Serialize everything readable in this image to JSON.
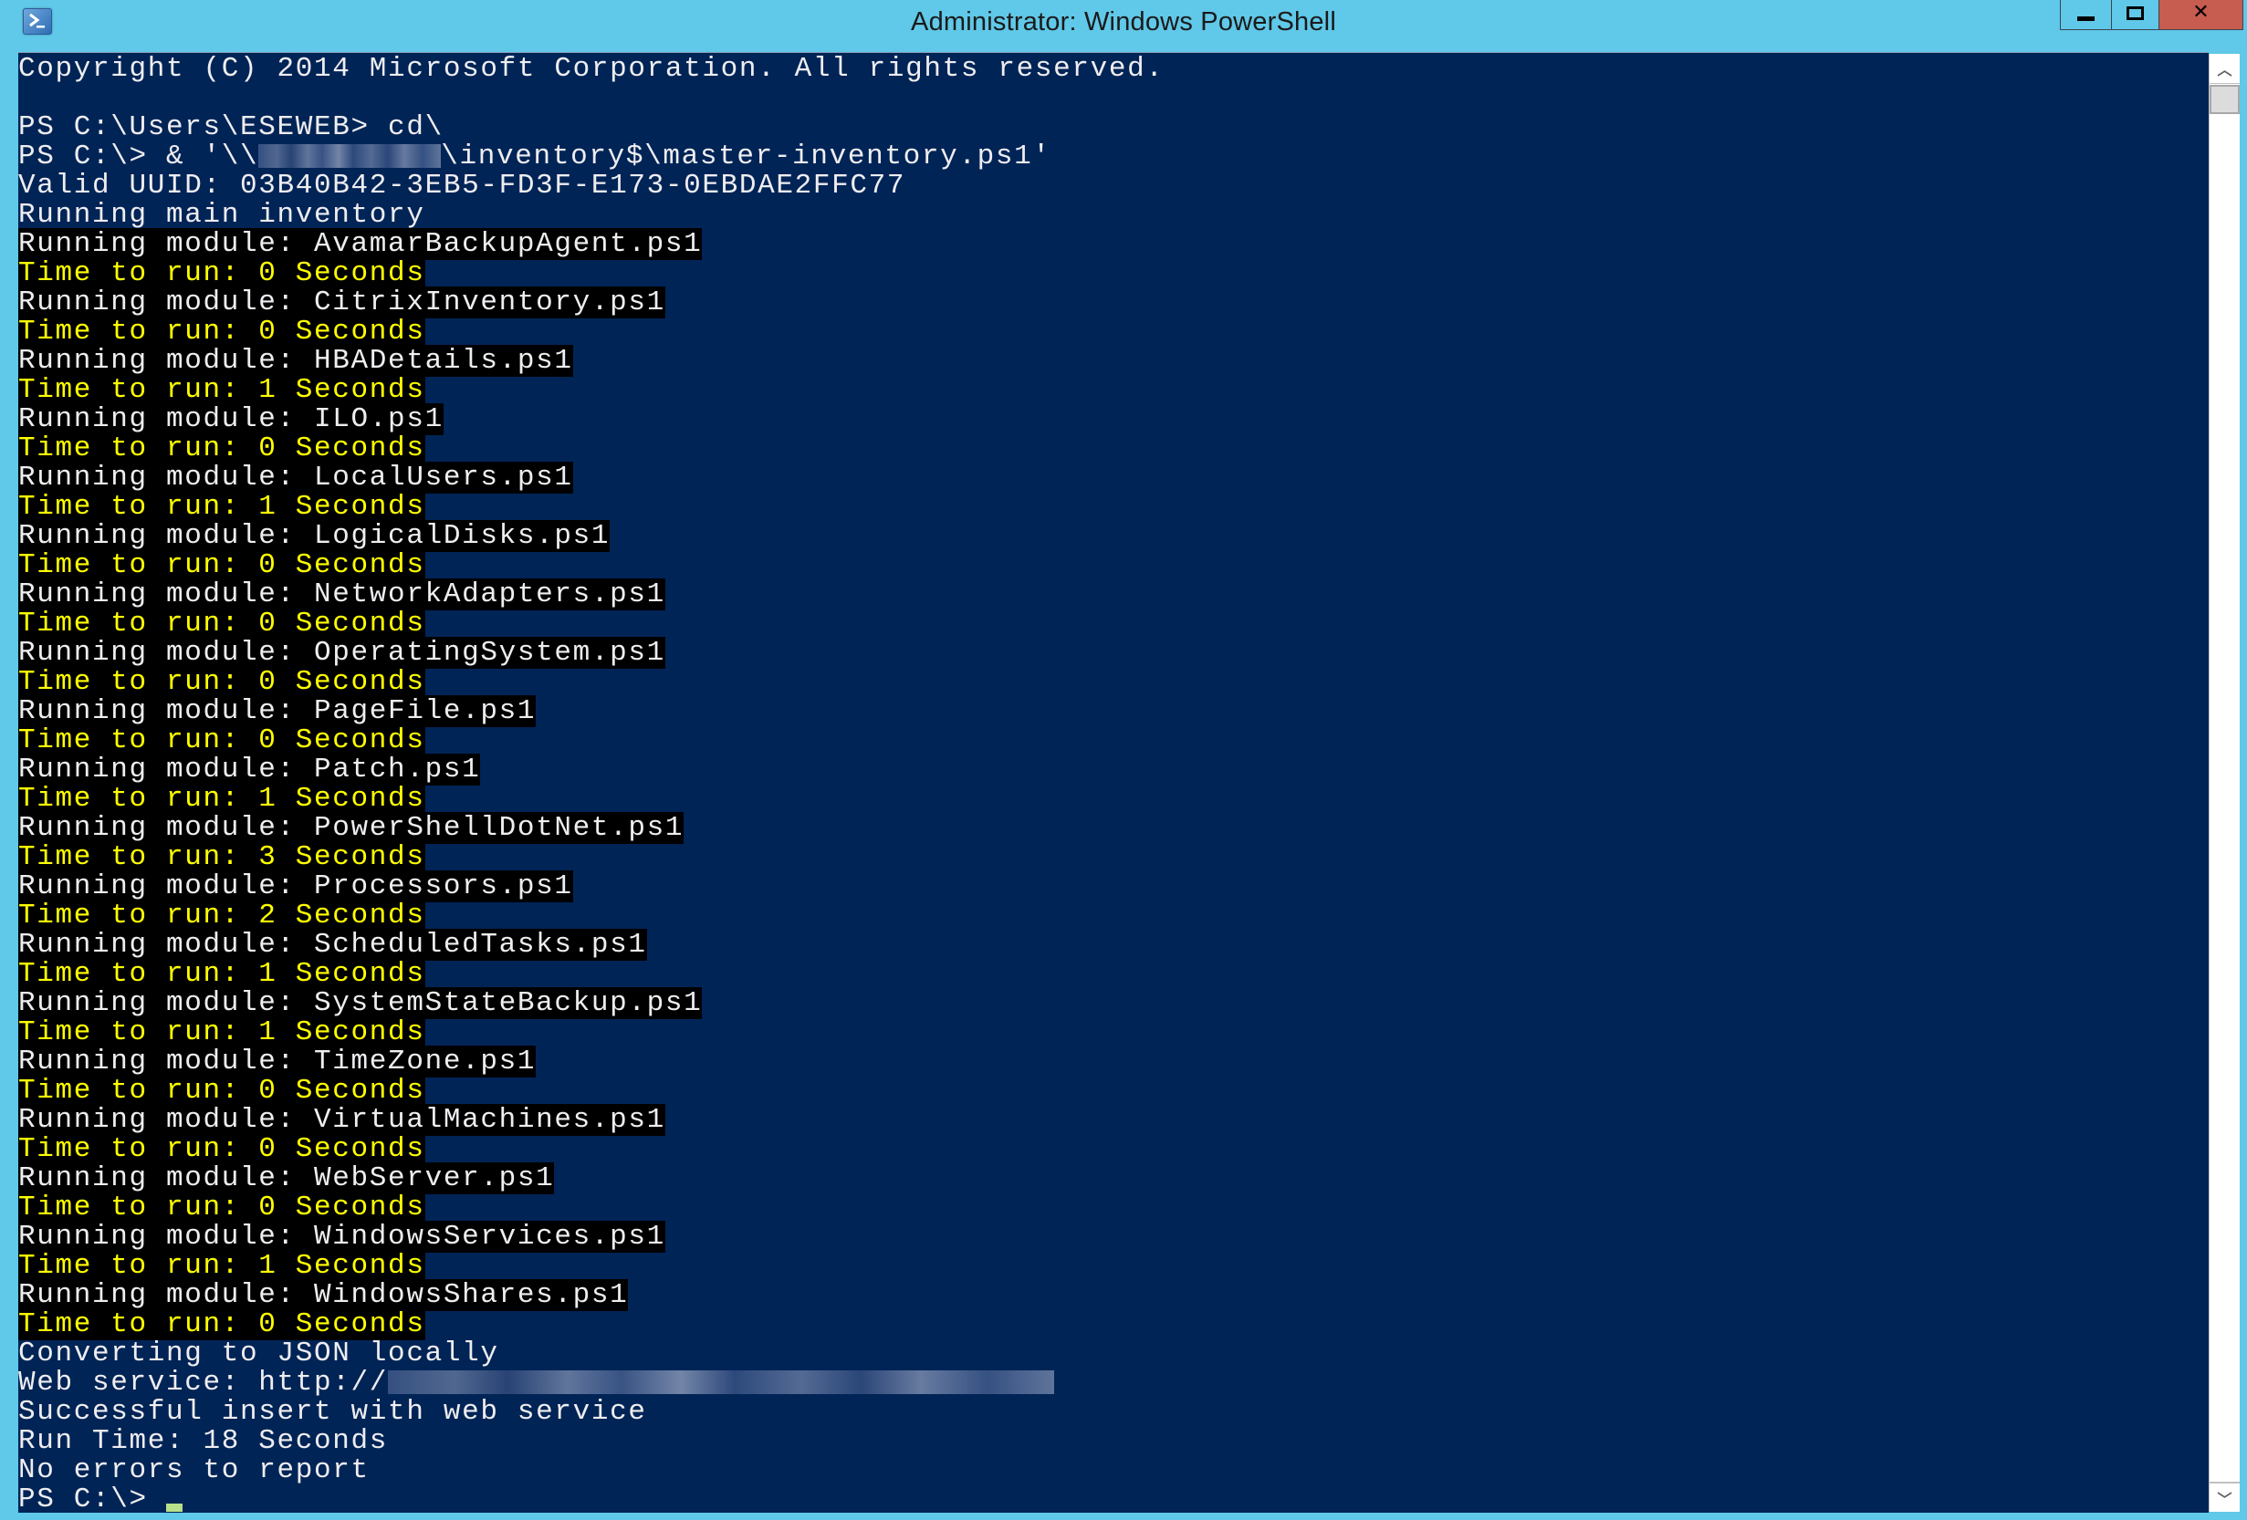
{
  "window": {
    "title": "Administrator: Windows PowerShell",
    "icon": "powershell-icon",
    "buttons": {
      "minimize": "minimize",
      "maximize": "maximize",
      "close": "close"
    },
    "colors": {
      "titlebar": "#60c8e8",
      "console_bg": "#012456",
      "text": "#eeedf0",
      "highlight_bg": "#000000",
      "warning_text": "#ffff00",
      "close_button": "#c75c50"
    }
  },
  "console": {
    "header": [
      "Copyright (C) 2014 Microsoft Corporation. All rights reserved.",
      "",
      "PS C:\\Users\\ESEWEB> cd\\"
    ],
    "command": {
      "prefix": "PS C:\\> & '\\\\",
      "redacted": "[redacted]",
      "suffix": "\\inventory$\\master-inventory.ps1'"
    },
    "pre_modules": [
      "Valid UUID: 03B40B42-3EB5-FD3F-E173-0EBDAE2FFC77",
      "Running main inventory"
    ],
    "module_prefix": "Running module: ",
    "time_prefix": "Time to run: ",
    "time_suffix": " Seconds",
    "modules": [
      {
        "name": "AvamarBackupAgent.ps1",
        "seconds": "0"
      },
      {
        "name": "CitrixInventory.ps1",
        "seconds": "0"
      },
      {
        "name": "HBADetails.ps1",
        "seconds": "1"
      },
      {
        "name": "ILO.ps1",
        "seconds": "0"
      },
      {
        "name": "LocalUsers.ps1",
        "seconds": "1"
      },
      {
        "name": "LogicalDisks.ps1",
        "seconds": "0"
      },
      {
        "name": "NetworkAdapters.ps1",
        "seconds": "0"
      },
      {
        "name": "OperatingSystem.ps1",
        "seconds": "0"
      },
      {
        "name": "PageFile.ps1",
        "seconds": "0"
      },
      {
        "name": "Patch.ps1",
        "seconds": "1"
      },
      {
        "name": "PowerShellDotNet.ps1",
        "seconds": "3"
      },
      {
        "name": "Processors.ps1",
        "seconds": "2"
      },
      {
        "name": "ScheduledTasks.ps1",
        "seconds": "1"
      },
      {
        "name": "SystemStateBackup.ps1",
        "seconds": "1"
      },
      {
        "name": "TimeZone.ps1",
        "seconds": "0"
      },
      {
        "name": "VirtualMachines.ps1",
        "seconds": "0"
      },
      {
        "name": "WebServer.ps1",
        "seconds": "0"
      },
      {
        "name": "WindowsServices.ps1",
        "seconds": "1"
      },
      {
        "name": "WindowsShares.ps1",
        "seconds": "0"
      }
    ],
    "converting": "Converting to JSON locally",
    "web_service": {
      "prefix": "Web service: http://",
      "redacted": "[redacted]"
    },
    "post_lines": [
      "Successful insert with web service",
      "Run Time: 18 Seconds",
      "No errors to report"
    ],
    "prompt": "PS C:\\> "
  },
  "scrollbar": {
    "up": "scroll-up",
    "down": "scroll-down",
    "position": 0
  }
}
